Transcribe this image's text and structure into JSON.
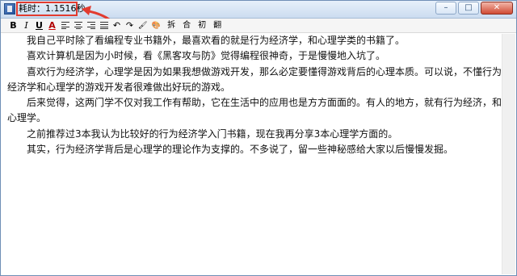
{
  "window": {
    "title_label": "耗时",
    "title_value": "：1.1516秒",
    "controls": {
      "minimize": "–",
      "maximize": "□",
      "close": "✕"
    }
  },
  "toolbar": {
    "bold": "B",
    "italic": "I",
    "underline": "U",
    "font_color": "A",
    "undo_icon": "↶",
    "redo_icon": "↷",
    "brush_icon": "🖌",
    "palette_icon": "🎨",
    "split_label": "拆",
    "merge_label": "合",
    "init_label": "初",
    "flip_label": "翻"
  },
  "editor": {
    "paragraphs": [
      "我自己平时除了看编程专业书籍外，最喜欢看的就是行为经济学，和心理学类的书籍了。",
      "喜欢计算机是因为小时候，看《黑客攻与防》觉得编程很神奇，于是慢慢地入坑了。",
      "喜欢行为经济学，心理学是因为如果我想做游戏开发，那么必定要懂得游戏背后的心理本质。可以说，不懂行为经济学和心理学的游戏开发者很难做出好玩的游戏。",
      "后来觉得，这两门学不仅对我工作有帮助，它在生活中的应用也是方方面面的。有人的地方，就有行为经济，和心理学。",
      "之前推荐过3本我认为比较好的行为经济学入门书籍，现在我再分享3本心理学方面的。",
      "其实，行为经济学背后是心理学的理论作为支撑的。不多说了，留一些神秘感给大家以后慢慢发掘。"
    ]
  },
  "annotation": {
    "highlight_color": "#e23b2f"
  }
}
